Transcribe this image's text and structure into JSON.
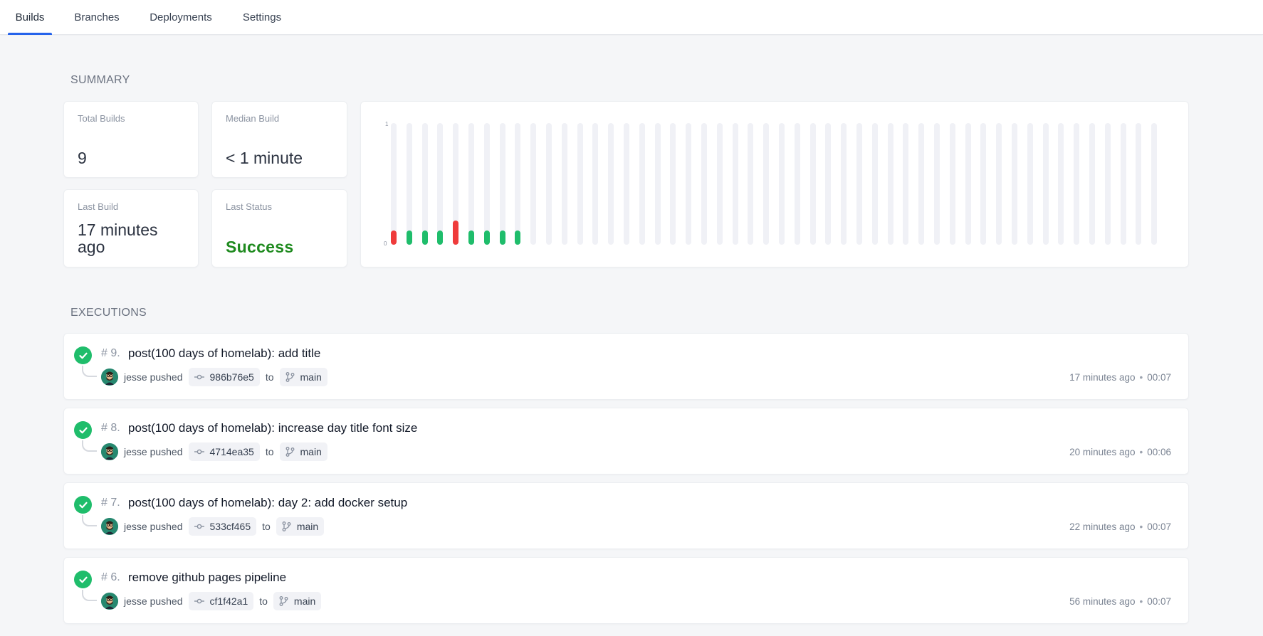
{
  "tabs": [
    "Builds",
    "Branches",
    "Deployments",
    "Settings"
  ],
  "summary": {
    "title": "SUMMARY",
    "total_builds_label": "Total Builds",
    "total_builds_value": "9",
    "median_build_label": "Median Build",
    "median_build_value": "< 1 minute",
    "last_build_label": "Last Build",
    "last_build_value": "17 minutes ago",
    "last_status_label": "Last Status",
    "last_status_value": "Success"
  },
  "chart_data": {
    "type": "bar",
    "y_max_label": "1",
    "y_min_label": "0",
    "total_slots": 50,
    "values": [
      0.1,
      0.1,
      0.1,
      0.1,
      0.17,
      0.1,
      0.1,
      0.1,
      0.1
    ],
    "statuses": [
      "failure",
      "success",
      "success",
      "success",
      "failure",
      "success",
      "success",
      "success",
      "success"
    ],
    "colors": {
      "success": "#1fbd6b",
      "failure": "#ef3b3b",
      "empty": "#f0f1f6"
    }
  },
  "executions": {
    "title": "EXECUTIONS",
    "items": [
      {
        "number": "# 9.",
        "message": "post(100 days of homelab): add title",
        "author": "jesse pushed",
        "commit": "986b76e5",
        "to": "to",
        "branch": "main",
        "time": "17 minutes ago",
        "duration": "00:07"
      },
      {
        "number": "# 8.",
        "message": "post(100 days of homelab): increase day title font size",
        "author": "jesse pushed",
        "commit": "4714ea35",
        "to": "to",
        "branch": "main",
        "time": "20 minutes ago",
        "duration": "00:06"
      },
      {
        "number": "# 7.",
        "message": "post(100 days of homelab): day 2: add docker setup",
        "author": "jesse pushed",
        "commit": "533cf465",
        "to": "to",
        "branch": "main",
        "time": "22 minutes ago",
        "duration": "00:07"
      },
      {
        "number": "# 6.",
        "message": "remove github pages pipeline",
        "author": "jesse pushed",
        "commit": "cf1f42a1",
        "to": "to",
        "branch": "main",
        "time": "56 minutes ago",
        "duration": "00:07"
      }
    ]
  }
}
